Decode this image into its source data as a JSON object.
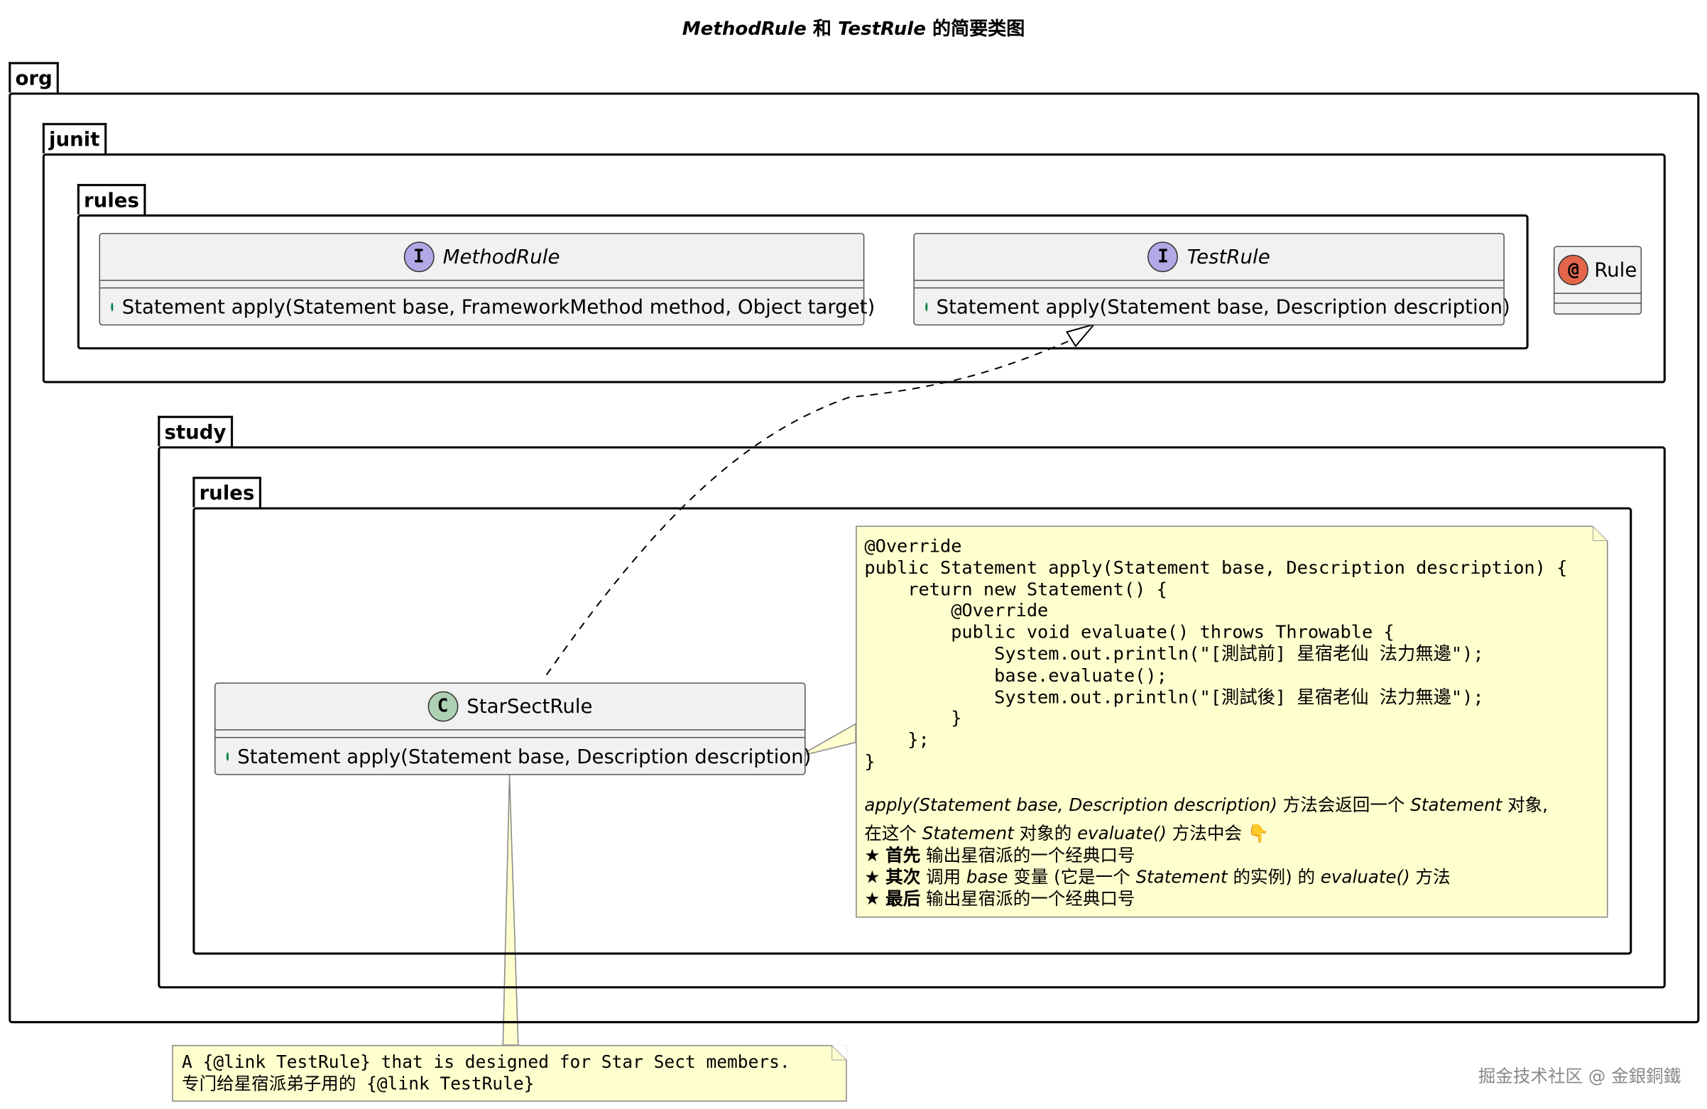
{
  "title": {
    "part1": "MethodRule",
    "mid": " 和 ",
    "part2": "TestRule",
    "suffix": " 的简要类图"
  },
  "packages": {
    "org": "org",
    "junit": "junit",
    "junit_rules": "rules",
    "study": "study",
    "study_rules": "rules"
  },
  "classes": {
    "method_rule": {
      "spot": "I",
      "name": "MethodRule",
      "member": "Statement apply(Statement base, FrameworkMethod method, Object target)"
    },
    "test_rule": {
      "spot": "I",
      "name": "TestRule",
      "member": "Statement apply(Statement base, Description description)"
    },
    "rule": {
      "spot": "@",
      "name": "Rule"
    },
    "star_sect_rule": {
      "spot": "C",
      "name": "StarSectRule",
      "member": "Statement apply(Statement base, Description description)"
    }
  },
  "code_note": {
    "code": "@Override\npublic Statement apply(Statement base, Description description) {\n    return new Statement() {\n        @Override\n        public void evaluate() throws Throwable {\n            System.out.println(\"[測試前] 星宿老仙 法力無邊\");\n            base.evaluate();\n            System.out.println(\"[測試後] 星宿老仙 法力無邊\");\n        }\n    };\n}",
    "l1_a": "apply(Statement base, Description description)",
    "l1_b": " 方法会返回一个 ",
    "l1_c": "Statement",
    "l1_d": " 对象,",
    "l2_a": "在这个 ",
    "l2_b": "Statement",
    "l2_c": " 对象的 ",
    "l2_d": "evaluate()",
    "l2_e": " 方法中会 ",
    "l2_emoji": "👇",
    "b1_star": "★ ",
    "b1_bold": "首先",
    "b1_rest": " 输出星宿派的一个经典口号",
    "b2_star": "★ ",
    "b2_bold": "其次",
    "b2_a": " 调用 ",
    "b2_b": "base",
    "b2_c": " 变量 (它是一个 ",
    "b2_d": "Statement",
    "b2_e": " 的实例) 的 ",
    "b2_f": "evaluate()",
    "b2_g": " 方法",
    "b3_star": "★ ",
    "b3_bold": "最后",
    "b3_rest": " 输出星宿派的一个经典口号"
  },
  "bottom_note": {
    "line1": "A {@link TestRule} that is designed for Star Sect members.",
    "line2": "专门给星宿派弟子用的 {@link TestRule}"
  },
  "watermark": "掘金技术社区 @ 金銀銅鐵",
  "colors": {
    "interface_spot": "#b4a7e5",
    "class_spot": "#add1b2",
    "annotation_spot": "#e3664a",
    "class_bg": "#f1f1f1",
    "note_bg": "#fefece",
    "public_dot": "#84be84"
  }
}
